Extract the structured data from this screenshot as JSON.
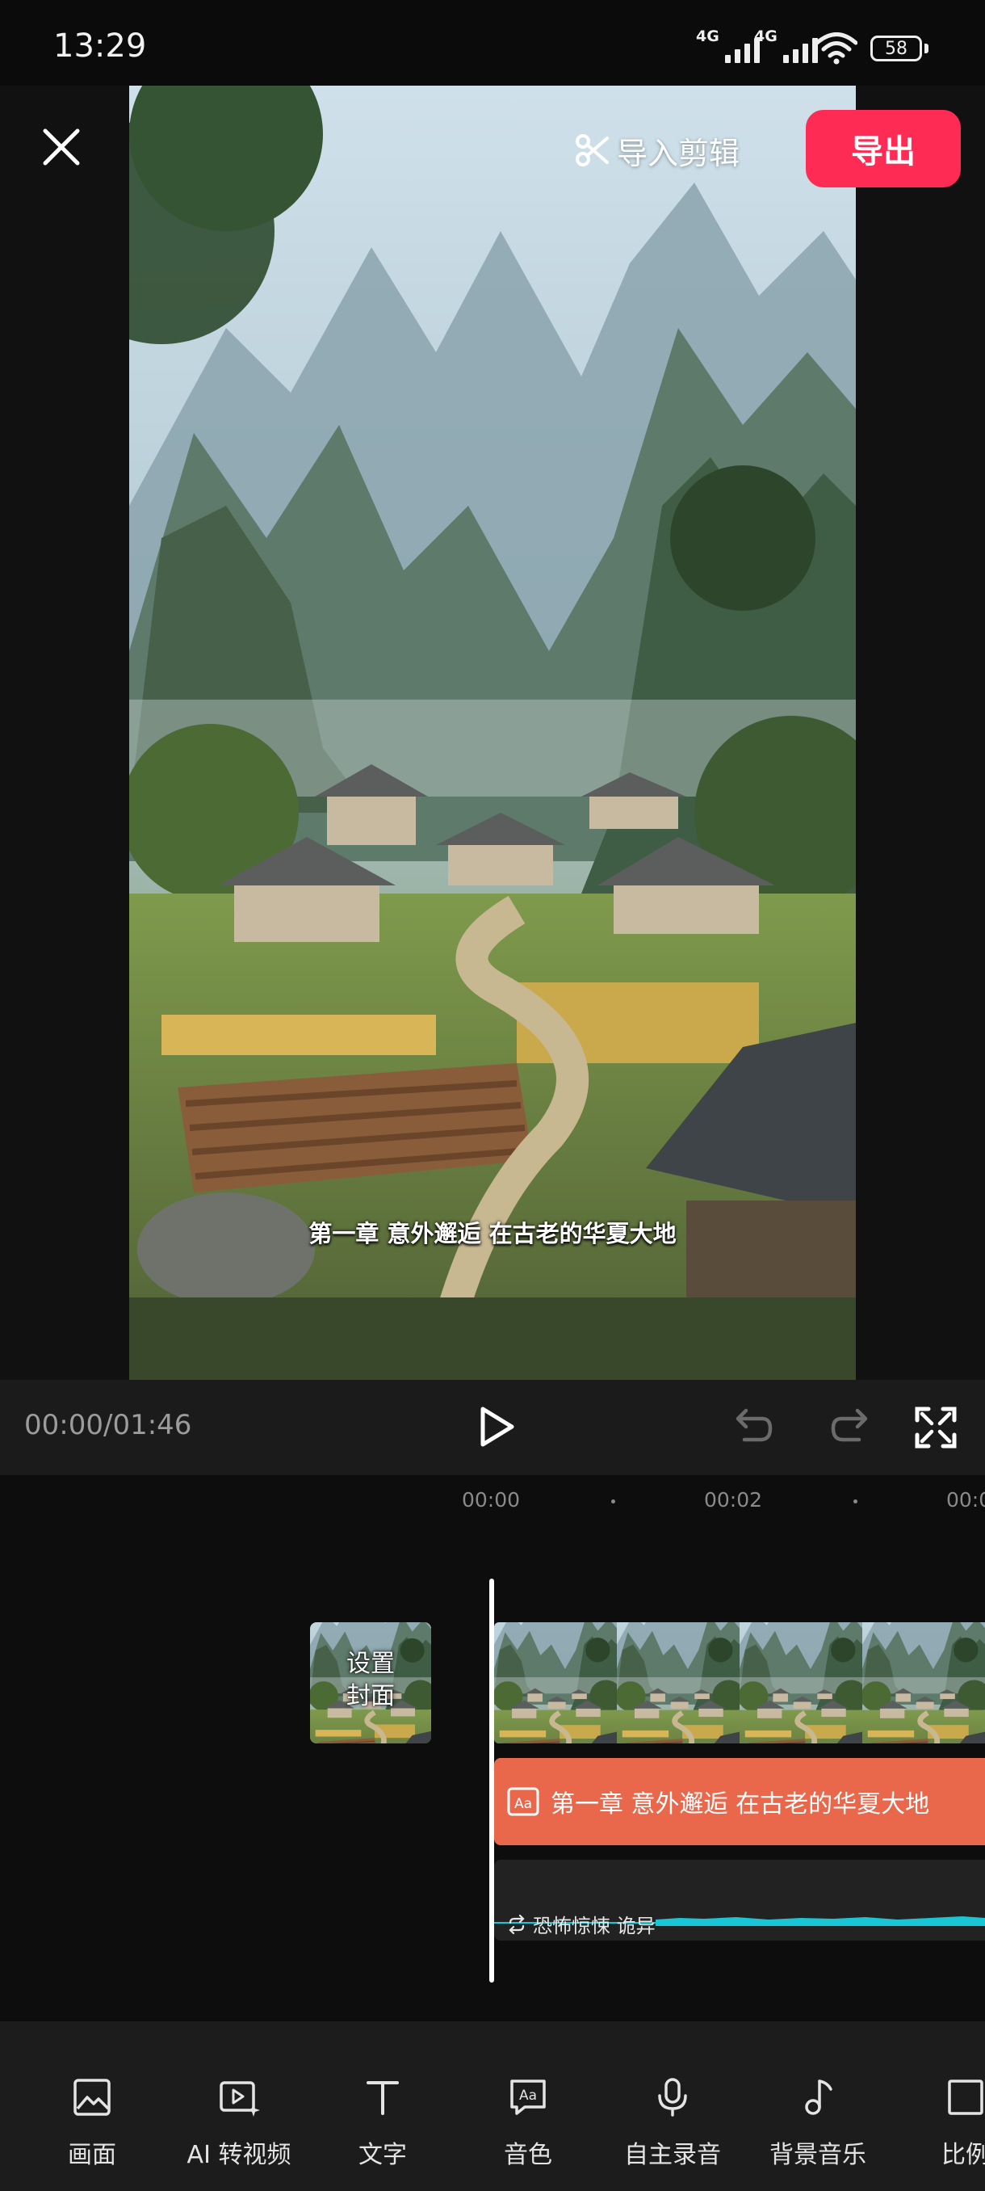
{
  "status_bar": {
    "time": "13:29",
    "signal_1": "4G",
    "signal_2": "4G",
    "battery": "58"
  },
  "header": {
    "import_edit_label": "导入剪辑",
    "export_label": "导出",
    "accent_color": "#fe2c55"
  },
  "preview": {
    "subtitle": "第一章 意外邂逅 在古老的华夏大地"
  },
  "playback": {
    "timecode": "00:00/01:46"
  },
  "timeline": {
    "ticks": [
      "00:00",
      "00:02",
      "00:0"
    ],
    "cover_label_line1": "设置",
    "cover_label_line2": "封面",
    "text_track_label": "第一章 意外邂逅 在古老的华夏大地",
    "text_track_color": "#e9674a",
    "audio_track_label": "恐怖惊悚 诡异",
    "waveform_color": "#19c6d6"
  },
  "toolbar": {
    "items": [
      {
        "label": "画面",
        "icon": "image-icon"
      },
      {
        "label": "AI 转视频",
        "icon": "ai-video-icon"
      },
      {
        "label": "文字",
        "icon": "text-icon"
      },
      {
        "label": "音色",
        "icon": "voice-tone-icon"
      },
      {
        "label": "自主录音",
        "icon": "microphone-icon"
      },
      {
        "label": "背景音乐",
        "icon": "music-note-icon"
      },
      {
        "label": "比例",
        "icon": "ratio-icon"
      }
    ]
  }
}
